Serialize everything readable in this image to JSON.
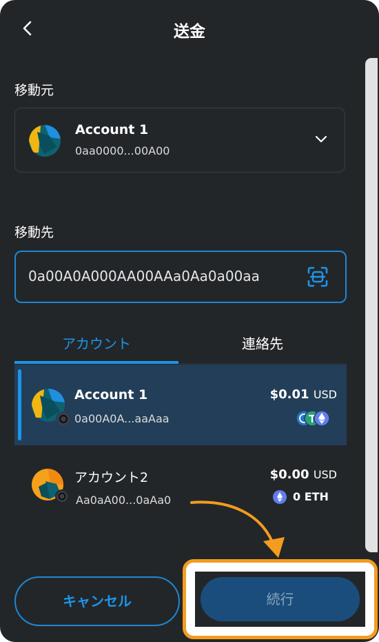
{
  "header": {
    "title": "送金"
  },
  "from_section": {
    "label": "移動元",
    "account_name": "Account 1",
    "account_address": "0aa0000...00A00"
  },
  "to_section": {
    "label": "移動先",
    "input_value": "0a00A0A000AA00AAa0Aa0a00aa"
  },
  "tabs": [
    {
      "label": "アカウント",
      "active": true
    },
    {
      "label": "連絡先",
      "active": false
    }
  ],
  "accounts": [
    {
      "name": "Account 1",
      "address": "0a00A0A...aaAaa",
      "balance": "$0.01",
      "currency": "USD",
      "token_icons": [
        "usdc-icon",
        "tether-icon",
        "eth-icon"
      ],
      "selected": true
    },
    {
      "name": "アカウント2",
      "address": "Aa0aA00...0aAa0",
      "balance": "$0.00",
      "currency": "USD",
      "token_text": "0 ETH",
      "selected": false
    }
  ],
  "buttons": {
    "cancel": "キャンセル",
    "next": "続行"
  },
  "colors": {
    "background": "#232629",
    "accent": "#1c96ea",
    "highlight": "#f39c1f",
    "selected_row": "#233e58"
  }
}
